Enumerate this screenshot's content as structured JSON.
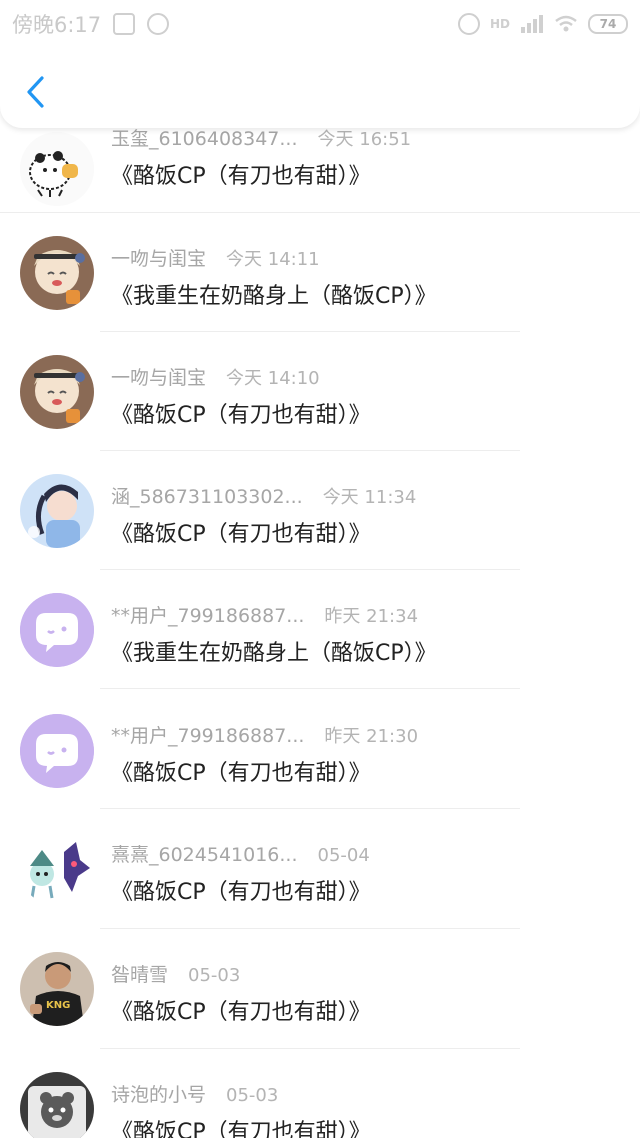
{
  "status_bar": {
    "time": "傍晚6:17",
    "signal_label": "HD",
    "battery": "74"
  },
  "header": {
    "back_icon": "chevron-left-icon",
    "accent": "#2196f3"
  },
  "rows": [
    {
      "username": "玉玺_6106408347...",
      "time": "今天 16:51",
      "title": "《酪饭CP（有刀也有甜）》",
      "avatar": "panda-sticker"
    },
    {
      "username": "一吻与闺宝",
      "time": "今天 14:11",
      "title": "《我重生在奶酪身上（酪饭CP）》",
      "avatar": "anime-girl"
    },
    {
      "username": "一吻与闺宝",
      "time": "今天 14:10",
      "title": "《酪饭CP（有刀也有甜）》",
      "avatar": "anime-girl"
    },
    {
      "username": "涵_586731103302...",
      "time": "今天 11:34",
      "title": "《酪饭CP（有刀也有甜）》",
      "avatar": "blue-girl"
    },
    {
      "username": "**用户_799186887...",
      "time": "昨天 21:34",
      "title": "《我重生在奶酪身上（酪饭CP）》",
      "avatar": "default-purple"
    },
    {
      "username": "**用户_799186887...",
      "time": "昨天 21:30",
      "title": "《酪饭CP（有刀也有甜）》",
      "avatar": "default-purple"
    },
    {
      "username": "熹熹_6024541016...",
      "time": "05-04",
      "title": "《酪饭CP（有刀也有甜）》",
      "avatar": "game-characters"
    },
    {
      "username": "昝晴雪",
      "time": "05-03",
      "title": "《酪饭CP（有刀也有甜）》",
      "avatar": "boy-photo"
    },
    {
      "username": "诗泡的小号",
      "time": "05-03",
      "title": "《酪饭CP（有刀也有甜）》",
      "avatar": "bear-sticker"
    }
  ]
}
